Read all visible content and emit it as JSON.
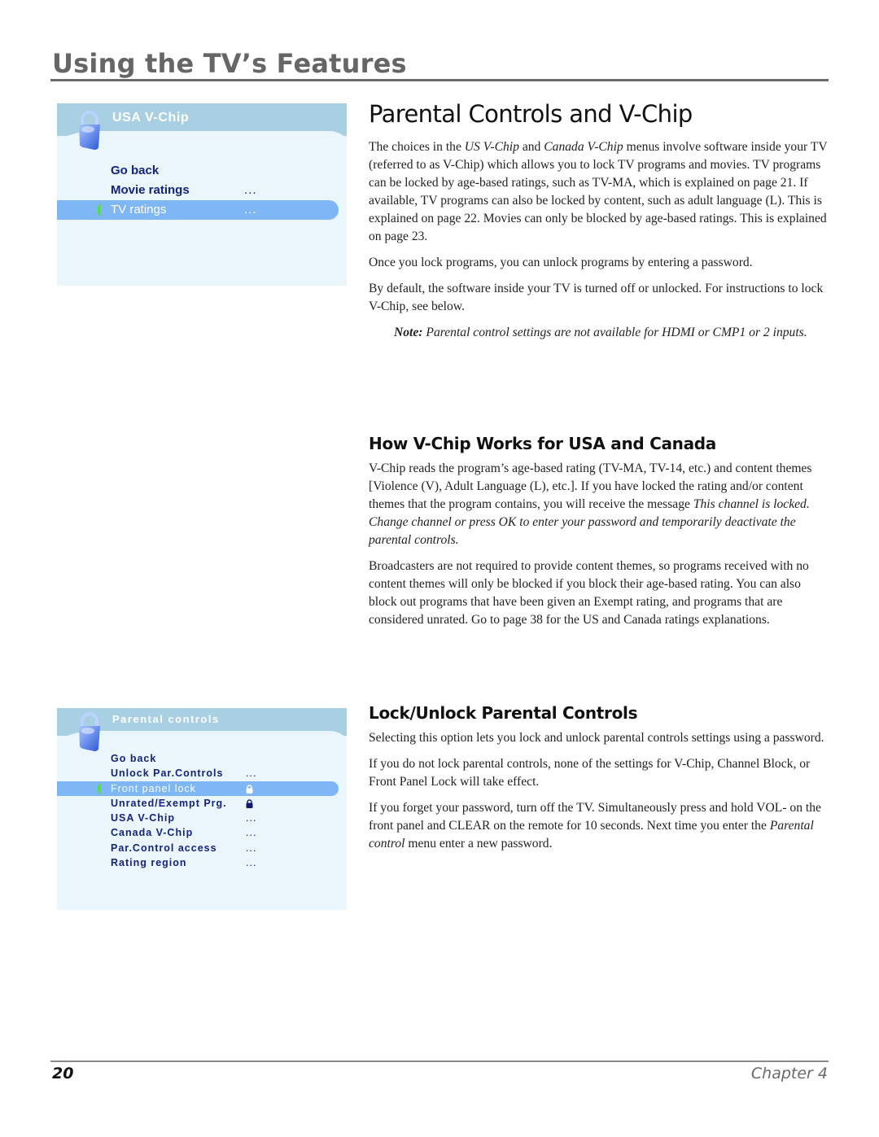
{
  "header": {
    "chapter_title": "Using the TV’s Features"
  },
  "menus": {
    "vchip": {
      "title": "USA V-Chip",
      "icon": "padlock-icon",
      "items": [
        {
          "label": "Go back",
          "value": ""
        },
        {
          "label": "Movie ratings",
          "value": "..."
        },
        {
          "label": "TV ratings",
          "value": "...",
          "selected": true
        }
      ]
    },
    "parental": {
      "title": "Parental controls",
      "icon": "padlock-icon",
      "items": [
        {
          "label": "Go back",
          "value": ""
        },
        {
          "label": "Unlock Par.Controls",
          "value": "..."
        },
        {
          "label": "Front panel lock",
          "value": "unlocked-lock-icon",
          "selected": true
        },
        {
          "label": "Unrated/Exempt Prg.",
          "value": "locked-lock-icon"
        },
        {
          "label": "USA V-Chip",
          "value": "..."
        },
        {
          "label": "Canada V-Chip",
          "value": "..."
        },
        {
          "label": "Par.Control access",
          "value": "..."
        },
        {
          "label": "Rating region",
          "value": "..."
        }
      ]
    }
  },
  "main": {
    "title": "Parental Controls and V-Chip",
    "intro": {
      "p1_a": "The choices in the ",
      "p1_em1": "US V-Chip",
      "p1_b": " and ",
      "p1_em2": "Canada V-Chip",
      "p1_c": " menus involve software inside your TV (referred to as V-Chip) which allows you to lock TV programs and movies. TV programs can be locked by age-based ratings, such as TV-MA, which is explained on page 21. If available, TV programs can also be locked by content, such as adult language (L). This is explained on page 22. Movies can only be blocked by age-based ratings. This is explained on page 23.",
      "p2": "Once you lock programs, you can unlock programs by entering a password.",
      "p3_a": "By default, the software inside your TV is turned off or unlocked. For instructions to lock",
      "p3_b": "V-Chip, see below.",
      "note_label": "Note:",
      "note_text": " Parental control settings are not available for HDMI or CMP1 or 2 inputs."
    },
    "how_section": {
      "title": "How V-Chip Works for USA and Canada",
      "p1_a": "V-Chip reads the program’s age-based rating (TV-MA, TV-14, etc.) and content themes [Violence (V), Adult Language (L), etc.]. If you have locked the rating and/or content themes that the program contains, you will receive the message ",
      "p1_em": "This channel is locked. Change channel or press OK to enter your password and temporarily deactivate the parental controls.",
      "p2": "Broadcasters are not required to provide content themes, so programs received with no content themes will only be blocked if you block their age-based rating. You can also block out programs that have been given an Exempt rating, and programs that are considered unrated. Go to page 38 for the US and Canada ratings explanations."
    },
    "lock_section": {
      "title": "Lock/Unlock Parental Controls",
      "p1": "Selecting this option lets you lock and unlock parental controls settings using a password.",
      "p2": "If you do not lock parental controls, none of the settings for V-Chip, Channel Block, or Front Panel Lock will take effect.",
      "p3_a": "If you forget your password, turn off the TV. Simultaneously press and hold VOL- on the front panel and CLEAR on the remote for 10 seconds. Next time you enter the ",
      "p3_em": "Parental control",
      "p3_b": " menu enter a new password."
    }
  },
  "footer": {
    "page_number": "20",
    "chapter": "Chapter 4"
  },
  "colors": {
    "menu_header": "#a9d0e2",
    "menu_body": "#eaf6fc",
    "menu_selected": "#7fb6f6",
    "menu_text": "#14237e",
    "select_marker": "#4fe03a",
    "chapter_gray": "#666666"
  }
}
